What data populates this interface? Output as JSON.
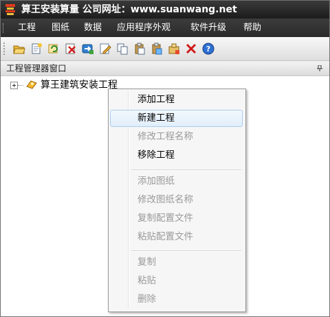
{
  "window": {
    "title": "算王安装算量 公司网址：www.suanwang.net"
  },
  "menubar": {
    "items": [
      "工程",
      "图纸",
      "数据",
      "应用程序外观",
      "软件升级",
      "帮助"
    ]
  },
  "toolbar": {
    "icons": [
      "open-folder-icon",
      "new-document-icon",
      "refresh-icon",
      "delete-red-icon",
      "export-icon",
      "edit-icon",
      "copy-icon",
      "paste-icon",
      "paste-special-icon",
      "package-icon",
      "close-red-icon",
      "help-icon"
    ]
  },
  "panel": {
    "title": "工程管理器窗口"
  },
  "tree": {
    "root_label": "算王建筑安装工程"
  },
  "context_menu": {
    "items": [
      {
        "label": "添加工程",
        "enabled": true
      },
      {
        "label": "新建工程",
        "enabled": true,
        "highlighted": true
      },
      {
        "label": "修改工程名称",
        "enabled": false
      },
      {
        "label": "移除工程",
        "enabled": true
      },
      {
        "label": "添加图纸",
        "enabled": false
      },
      {
        "label": "修改图纸名称",
        "enabled": false
      },
      {
        "label": "复制配置文件",
        "enabled": false
      },
      {
        "label": "粘贴配置文件",
        "enabled": false
      },
      {
        "label": "复制",
        "enabled": false
      },
      {
        "label": "粘贴",
        "enabled": false
      },
      {
        "label": "删除",
        "enabled": false
      }
    ]
  },
  "colors": {
    "title_bar": "#1c1c1c",
    "menu_bar": "#2a2a2a",
    "highlight_border": "#a9cdef",
    "disabled_text": "#9a9a9a"
  }
}
